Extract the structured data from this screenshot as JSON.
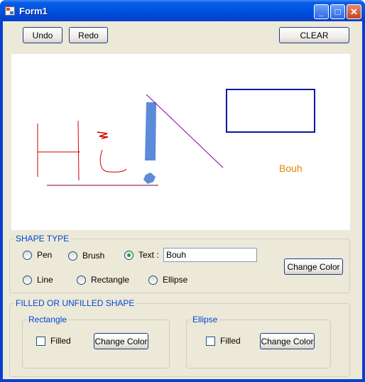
{
  "window": {
    "title": "Form1",
    "minimize_icon": "minimize-icon",
    "maximize_icon": "maximize-icon",
    "close_icon": "close-icon"
  },
  "toolbar": {
    "undo_label": "Undo",
    "redo_label": "Redo",
    "clear_label": "CLEAR"
  },
  "canvas": {
    "text_shape": "Bouh",
    "colors": {
      "red": "#d40000",
      "blue_fill": "#5b8bd9",
      "purple": "#8a00a8",
      "rect_stroke": "#0a1aa0",
      "text": "#e08a00"
    }
  },
  "shape_type": {
    "title": "SHAPE TYPE",
    "options": {
      "pen": "Pen",
      "brush": "Brush",
      "text": "Text :",
      "line": "Line",
      "rectangle": "Rectangle",
      "ellipse": "Ellipse"
    },
    "selected": "text",
    "text_value": "Bouh",
    "change_color_label": "Change Color"
  },
  "fill": {
    "title": "FILLED OR UNFILLED SHAPE",
    "rectangle": {
      "title": "Rectangle",
      "filled_label": "Filled",
      "filled": false,
      "change_color_label": "Change Color"
    },
    "ellipse": {
      "title": "Ellipse",
      "filled_label": "Filled",
      "filled": false,
      "change_color_label": "Change Color"
    }
  },
  "theme": {
    "client_bg": "#ece9d8",
    "group_label_color": "#0046d5",
    "titlebar": "#0054e3"
  }
}
